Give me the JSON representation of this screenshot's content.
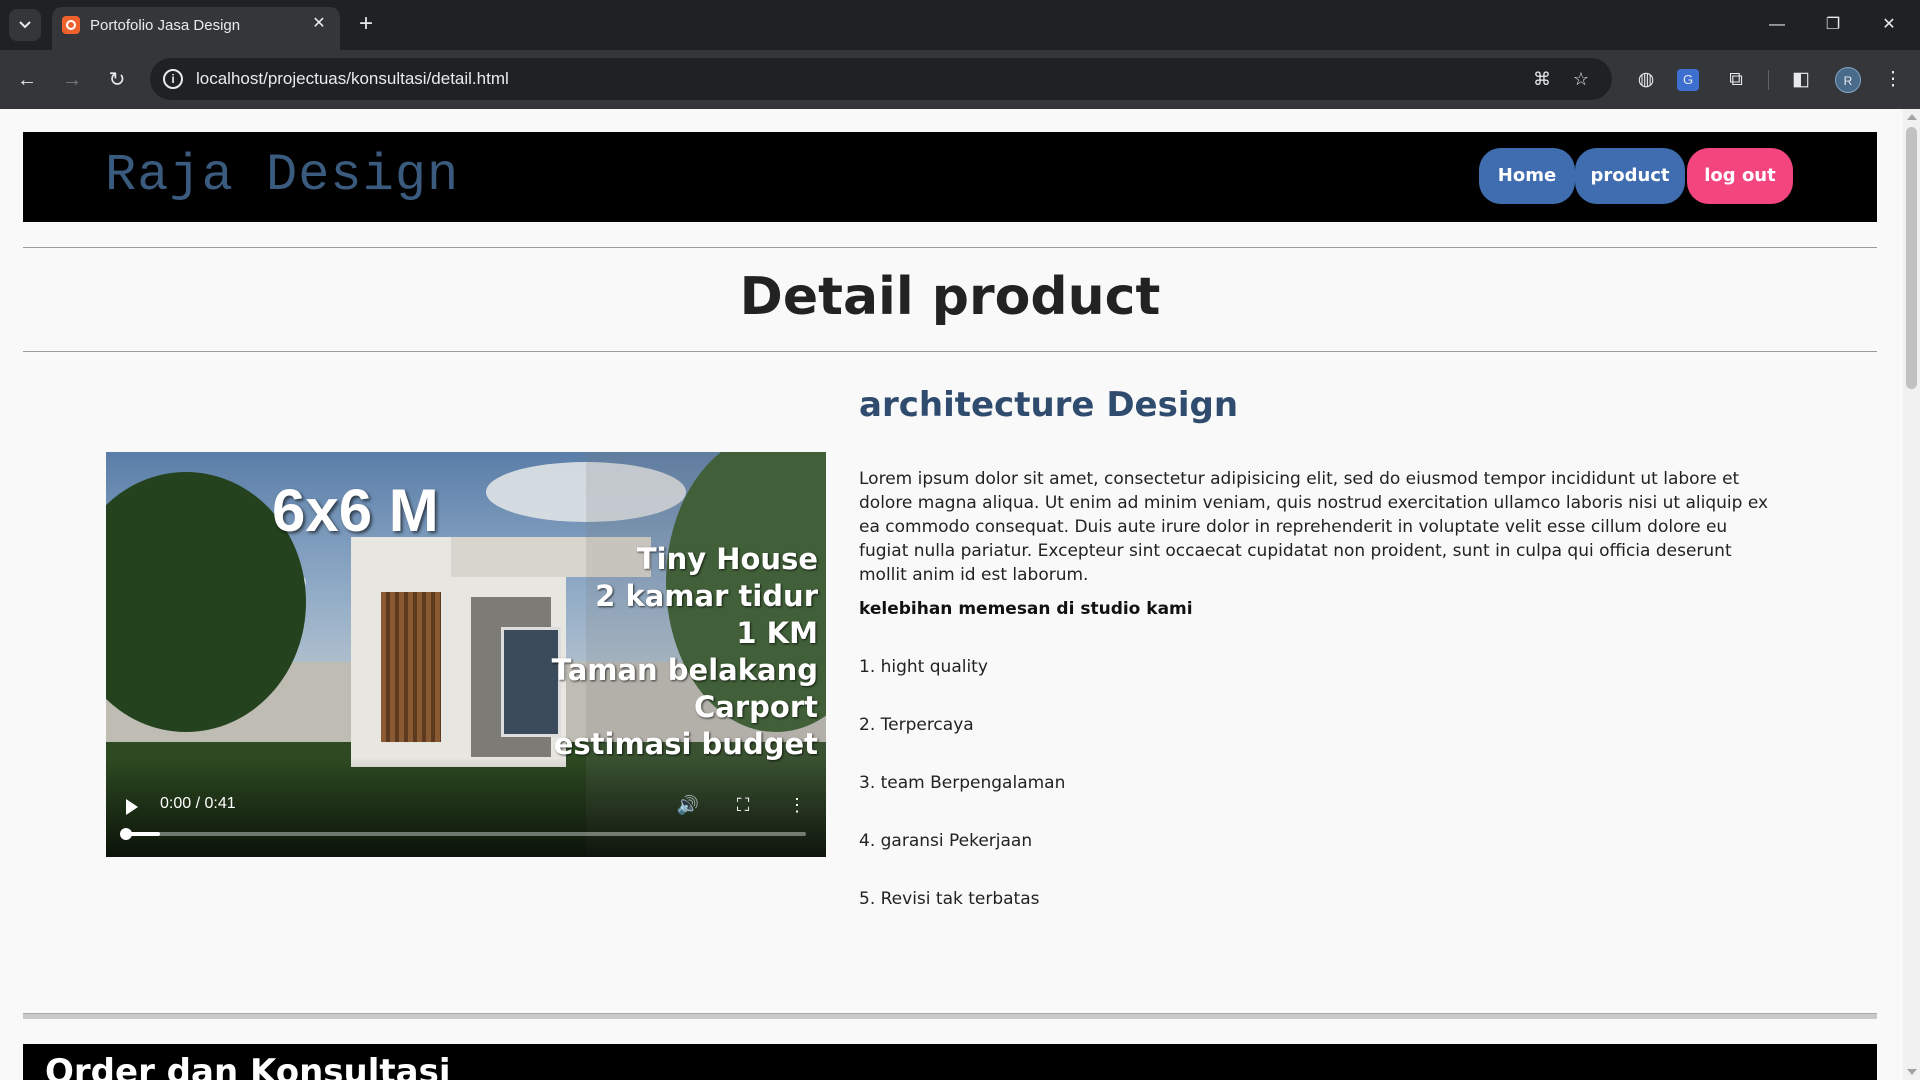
{
  "browser": {
    "tab_title": "Portofolio Jasa Design",
    "url": "localhost/projectuas/konsultasi/detail.html",
    "avatar_letter": "R"
  },
  "site": {
    "brand": "Raja Design",
    "nav": {
      "home": "Home",
      "product": "product",
      "logout": "log out"
    },
    "colors": {
      "nav_blue": "#3f6db0",
      "logout_pink": "#f4467e",
      "brand_text": "#3a5a7e"
    }
  },
  "page": {
    "title": "Detail product",
    "video": {
      "big_text": "6x6 M",
      "lines": [
        "Tiny House",
        "2 kamar tidur",
        "1 KM",
        "Taman belakang",
        "Carport",
        "estimasi budget"
      ],
      "time": "0:00 / 0:41",
      "progress": 0.05
    },
    "description": {
      "heading": "architecture Design",
      "paragraph": "Lorem ipsum dolor sit amet, consectetur adipisicing elit, sed do eiusmod tempor incididunt ut labore et dolore magna aliqua. Ut enim ad minim veniam, quis nostrud exercitation ullamco laboris nisi ut aliquip ex ea commodo consequat. Duis aute irure dolor in reprehenderit in voluptate velit esse cillum dolore eu fugiat nulla pariatur. Excepteur sint occaecat cupidatat non proident, sunt in culpa qui officia deserunt mollit anim id est laborum.",
      "advantages_title": "kelebihan memesan di studio kami",
      "advantages": [
        "1. hight quality",
        "2. Terpercaya",
        "3. team Berpengalaman",
        "4. garansi Pekerjaan",
        "5. Revisi tak terbatas"
      ]
    },
    "order_title": "Order dan Konsultasi"
  }
}
